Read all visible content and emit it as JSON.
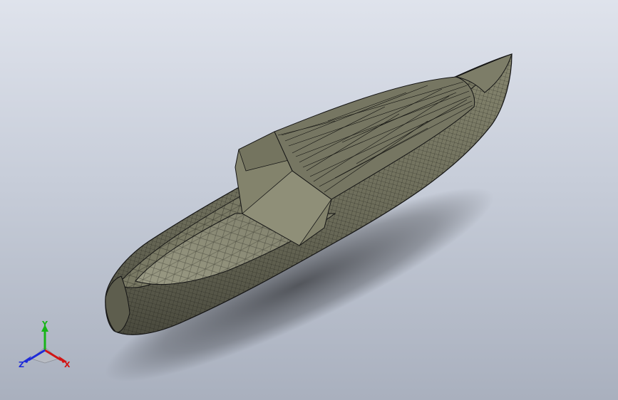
{
  "triad": {
    "x_label": "X",
    "y_label": "Y",
    "z_label": "Z",
    "x_color": "#d21414",
    "y_color": "#18b418",
    "z_color": "#1e2ad8"
  },
  "model": {
    "icon": "boat-mesh-model",
    "hull_color": "#6e6e5e",
    "deck_color": "#8c8c77",
    "edge_color": "#141414"
  }
}
